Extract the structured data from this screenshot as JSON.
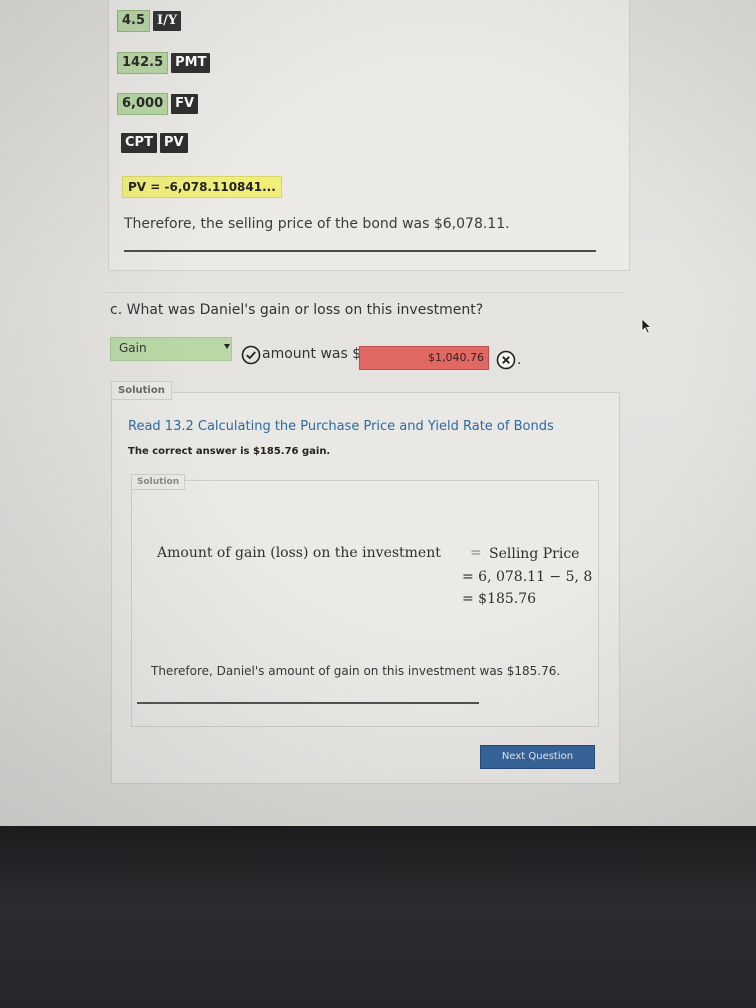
{
  "calculator": {
    "iy_value": "4.5",
    "iy_key": "I/Y",
    "pmt_value": "142.5",
    "pmt_key": "PMT",
    "fv_value": "6,000",
    "fv_key": "FV",
    "cpt_key": "CPT",
    "pv_key": "PV",
    "pv_result": "PV = -6,078.110841..."
  },
  "part_b": {
    "conclusion": "Therefore, the selling price of the bond was $6,078.11."
  },
  "part_c": {
    "question": "c. What was Daniel's gain or loss on this investment?",
    "select_value": "Gain",
    "amount_label": "amount was $",
    "answer_value": "$1,040.76",
    "trailing": "."
  },
  "solution": {
    "tab_label": "Solution",
    "link_text": "Read 13.2 Calculating the Purchase Price and Yield Rate of Bonds",
    "correct_text": "The correct answer is $185.76 gain.",
    "inner_tab_label": "Solution",
    "math_lhs": "Amount of gain (loss) on the investment",
    "math_eq": "=",
    "math_rhs": "Selling Price",
    "math_line2": "= 6, 078.11 − 5, 8",
    "math_line3": "= $185.76",
    "conclusion": "Therefore, Daniel's amount of gain on this investment was $185.76."
  },
  "buttons": {
    "next_question": "Next Question"
  },
  "icons": {
    "check": "check-circle-icon",
    "incorrect": "x-circle-icon",
    "dropdown": "caret-down-icon",
    "cursor": "mouse-cursor-icon"
  },
  "colors": {
    "input_green": "#b9d8a5",
    "wrong_red": "#e06a63",
    "highlight_yellow": "#f1ef7a",
    "link_blue": "#2d6aa0",
    "button_blue": "#2f5f98"
  }
}
